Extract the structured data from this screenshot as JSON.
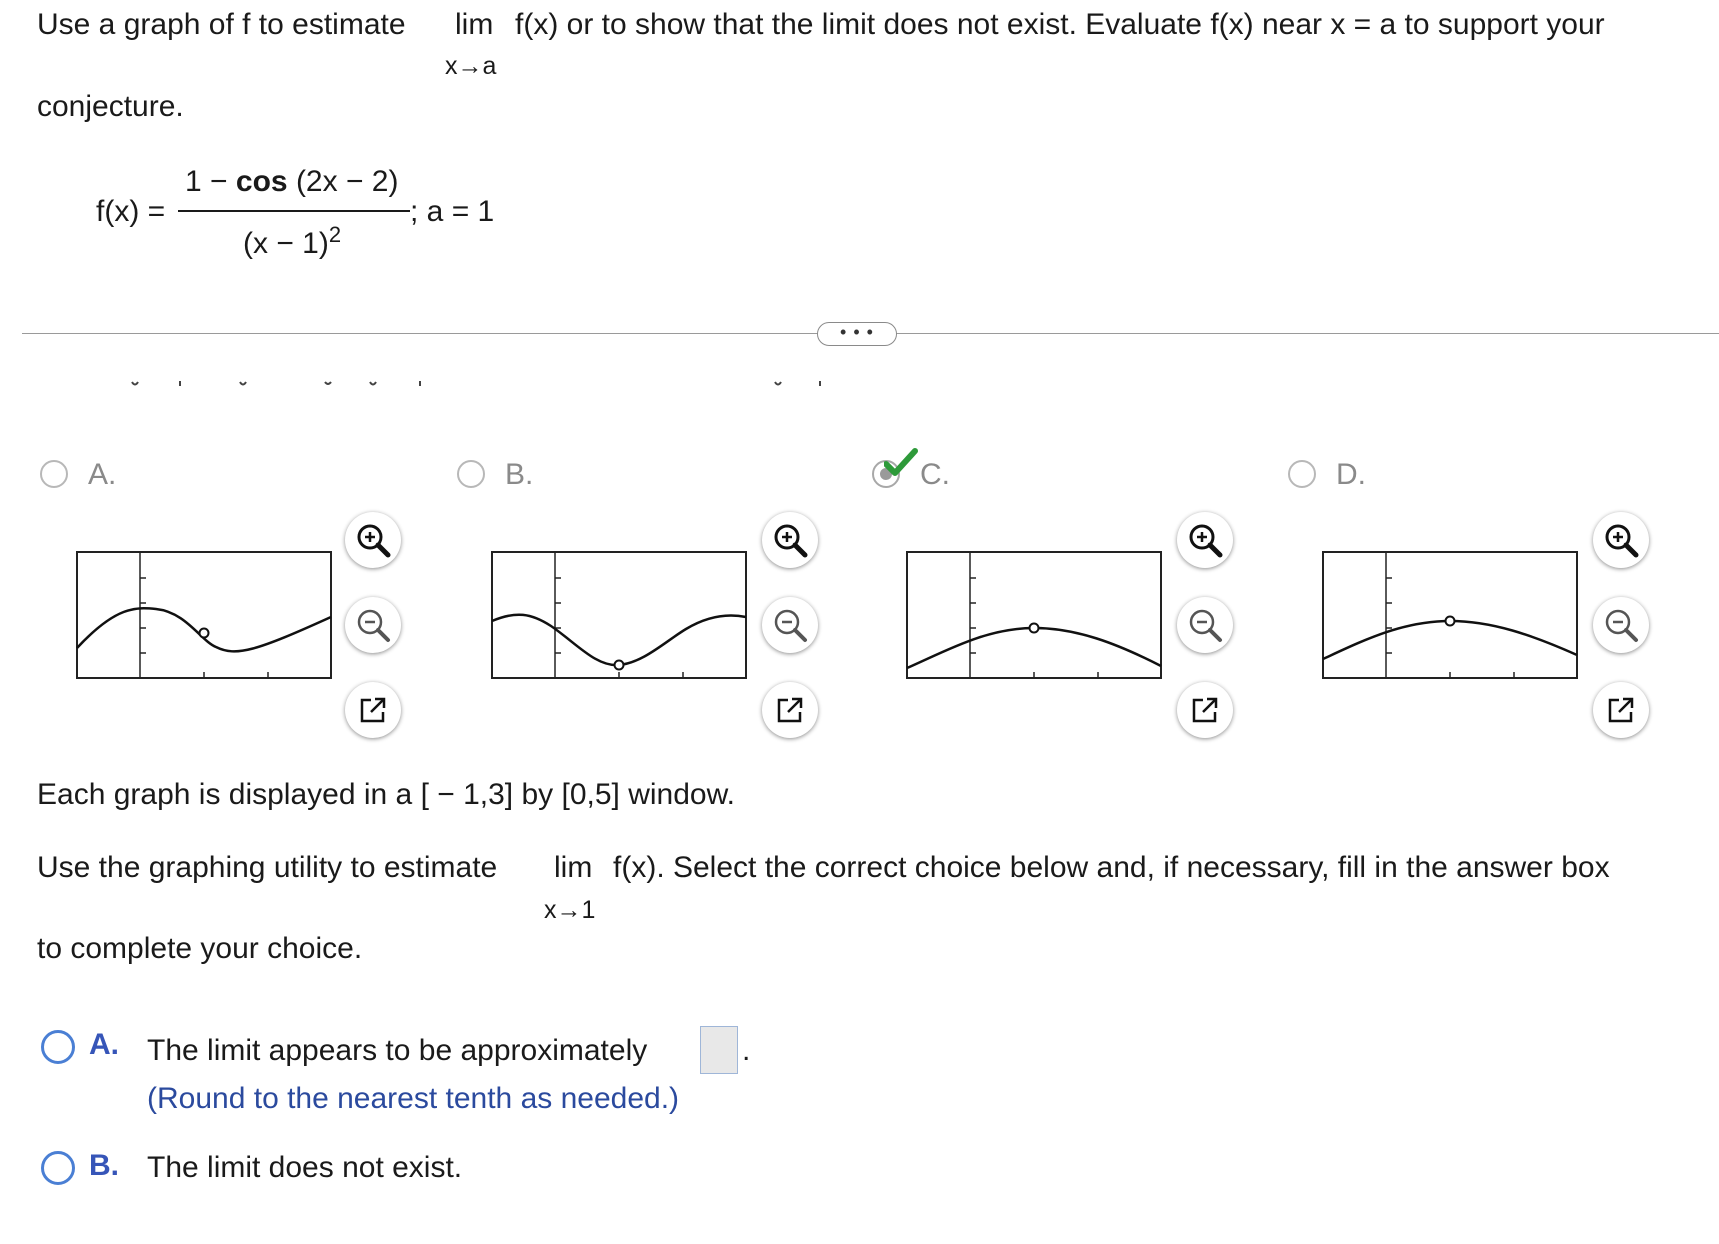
{
  "question": {
    "line1_a": "Use a graph of f to estimate",
    "lim_word": "lim",
    "line1_b": "f(x) or to show that the limit does not exist. Evaluate f(x) near x = a to support your",
    "lim_sub": "x→a",
    "line2": "conjecture."
  },
  "formula": {
    "fx": "f(x) =",
    "numerator_one": "1 −",
    "numerator_cos": "cos",
    "numerator_arg": "(2x − 2)",
    "denominator": "(x − 1)",
    "denominator_exp": "2",
    "after": "; a = 1"
  },
  "divider": {
    "more_label": "• • •"
  },
  "graph_options": [
    {
      "letter": "A.",
      "selected": false
    },
    {
      "letter": "B.",
      "selected": false
    },
    {
      "letter": "C.",
      "selected": true
    },
    {
      "letter": "D.",
      "selected": false
    }
  ],
  "tool_icons": [
    "zoom-in-icon",
    "zoom-out-icon",
    "open-new-window-icon"
  ],
  "window_note": "Each graph is displayed in a [ − 1,3] by [0,5] window.",
  "part2": {
    "line_a": "Use the graphing utility to estimate",
    "lim_word": "lim",
    "line_b": "f(x). Select the correct choice below and, if necessary, fill in the answer box",
    "lim_sub": "x→1",
    "line2": "to complete your choice."
  },
  "answer_choices": {
    "a_letter": "A.",
    "a_text": "The limit appears to be approximately",
    "a_period": ".",
    "a_hint": "(Round to the nearest tenth as needed.)",
    "a_value": "",
    "b_letter": "B.",
    "b_text": "The limit does not exist."
  },
  "colors": {
    "accent_blue": "#3655b8",
    "radio_blue": "#4a7fd4",
    "check_green": "#2e9a3a",
    "hint_blue": "#2b4a9e"
  }
}
